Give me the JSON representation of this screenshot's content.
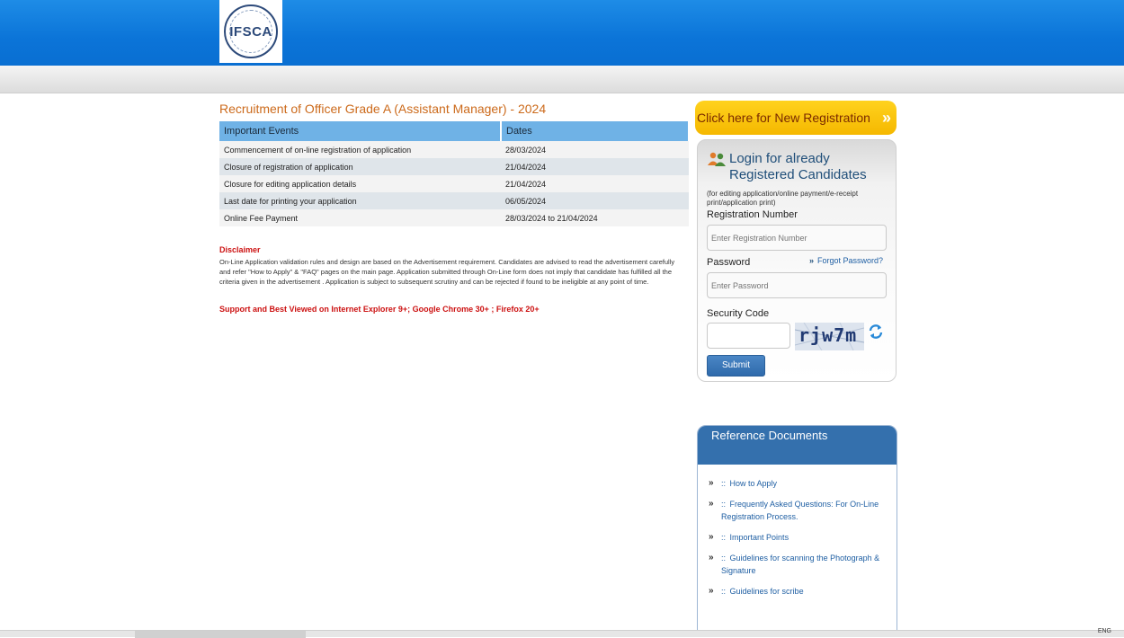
{
  "header": {
    "logo_text": "IFSCA",
    "logo_ring_text": "INTERNATIONAL FINANCIAL SERVICES CENTRES AUTHORITY"
  },
  "page_title": "Recruitment of Officer Grade A (Assistant Manager) - 2024",
  "events_table": {
    "headers": [
      "Important Events",
      "Dates"
    ],
    "rows": [
      [
        "Commencement of on-line registration of application",
        "28/03/2024"
      ],
      [
        "Closure of registration of application",
        "21/04/2024"
      ],
      [
        "Closure for editing application details",
        "21/04/2024"
      ],
      [
        "Last date for printing your application",
        "06/05/2024"
      ],
      [
        "Online Fee Payment",
        "28/03/2024 to 21/04/2024"
      ]
    ]
  },
  "disclaimer": {
    "title": "Disclaimer",
    "text": "On-Line Application validation rules and design are based on the Advertisement requirement. Candidates are advised to read the advertisement carefully and refer \"How to Apply\" & \"FAQ\" pages on the main page. Application submitted through On-Line form does not imply that candidate has fulfilled all the criteria given in the advertisement . Application is subject to subsequent scrutiny and can be rejected if found to be ineligible at any point of time."
  },
  "support_text": "Support and Best Viewed on Internet Explorer 9+; Google Chrome 30+ ; Firefox 20+",
  "new_registration": {
    "label": "Click here for New Registration",
    "arrow": "»"
  },
  "login": {
    "title_line1": "Login for already",
    "title_line2": "Registered Candidates",
    "note": "(for editing application/online payment/e-receipt print/application print)",
    "registration_label": "Registration Number",
    "registration_placeholder": "Enter Registration Number",
    "password_label": "Password",
    "forgot_label": "Forgot Password?",
    "forgot_arrow": "»",
    "password_placeholder": "Enter Password",
    "security_label": "Security Code",
    "captcha_text": "rjw7m",
    "submit_label": "Submit"
  },
  "reference": {
    "title": "Reference Documents",
    "arrow": "»",
    "prefix": "::",
    "items": [
      "How to Apply",
      "Frequently Asked Questions: For On-Line Registration Process.",
      "Important Points",
      "Guidelines for scanning the Photograph & Signature",
      "Guidelines for scribe"
    ]
  },
  "taskbar": {
    "lang": "ENG"
  },
  "colors": {
    "header_blue": "#0b74d8",
    "title_orange": "#cc6a1b",
    "table_header": "#6fb2e6",
    "alert_red": "#cc1111",
    "button_yellow": "#ffd21e",
    "panel_blue": "#3470ad"
  }
}
